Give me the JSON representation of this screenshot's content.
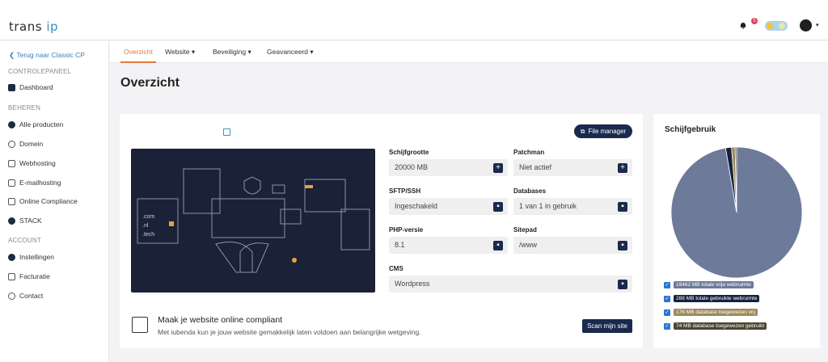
{
  "header": {
    "logo": "trans ip",
    "logo_a": "trans",
    "logo_b": "ip",
    "notifications": "5"
  },
  "sidebar": {
    "back": "Terug naar Classic CP",
    "sections": [
      {
        "title": "CONTROLEPANEEL",
        "items": [
          {
            "label": "Dashboard",
            "icon": "dashboard-icon"
          }
        ]
      },
      {
        "title": "BEHEREN",
        "items": [
          {
            "label": "Alle producten",
            "icon": "box-icon"
          },
          {
            "label": "Domein",
            "icon": "location-icon"
          },
          {
            "label": "Webhosting",
            "icon": "hosting-icon"
          },
          {
            "label": "E-mailhosting",
            "icon": "mail-icon"
          },
          {
            "label": "Online Compliance",
            "icon": "compliance-icon"
          },
          {
            "label": "STACK",
            "icon": "stack-icon"
          }
        ]
      },
      {
        "title": "ACCOUNT",
        "items": [
          {
            "label": "Instellingen",
            "icon": "gear-icon"
          },
          {
            "label": "Facturatie",
            "icon": "invoice-icon"
          },
          {
            "label": "Contact",
            "icon": "headset-icon"
          }
        ]
      }
    ]
  },
  "tabs": [
    {
      "label": "Overzicht",
      "active": true
    },
    {
      "label": "Website ▾"
    },
    {
      "label": "Beveiliging ▾"
    },
    {
      "label": "Geavanceerd ▾"
    }
  ],
  "page_title": "Overzicht",
  "overview": {
    "file_manager": "File manager",
    "fields": [
      {
        "label": "Schijfgrootte",
        "value": "20000 MB",
        "action": "plus"
      },
      {
        "label": "Patchman",
        "value": "Niet actief",
        "action": "plus"
      },
      {
        "label": "SFTP/SSH",
        "value": "Ingeschakeld",
        "action": "lock"
      },
      {
        "label": "Databases",
        "value": "1 van 1 in gebruik",
        "action": "lock"
      },
      {
        "label": "PHP-versie",
        "value": "8.1",
        "action": "lock"
      },
      {
        "label": "Sitepad",
        "value": "/www",
        "action": "lock"
      },
      {
        "label": "CMS",
        "value": "Wordpress",
        "action": "lock"
      }
    ],
    "illustration_text": [
      ".com",
      ".nl",
      ".tech"
    ]
  },
  "compliance": {
    "title": "Maak je website online compliant",
    "subtitle": "Met iubenda kun je jouw website gemakkelijk laten voldoen aan belangrijke wetgeving.",
    "button": "Scan mijn site"
  },
  "chart_data": {
    "type": "pie",
    "title": "Schijfgebruik",
    "legend_position": "bottom",
    "series": [
      {
        "name": "19462 MB totale vrije webruimte",
        "value": 19462,
        "color": "#6e7a9a"
      },
      {
        "name": "288 MB totale gebruikte webruimte",
        "value": 288,
        "color": "#14213d"
      },
      {
        "name": "176 MB database toegewezen vrij",
        "value": 176,
        "color": "#9c8a5a"
      },
      {
        "name": "74 MB database toegewezen gebruikt",
        "value": 74,
        "color": "#4a4630"
      }
    ]
  }
}
